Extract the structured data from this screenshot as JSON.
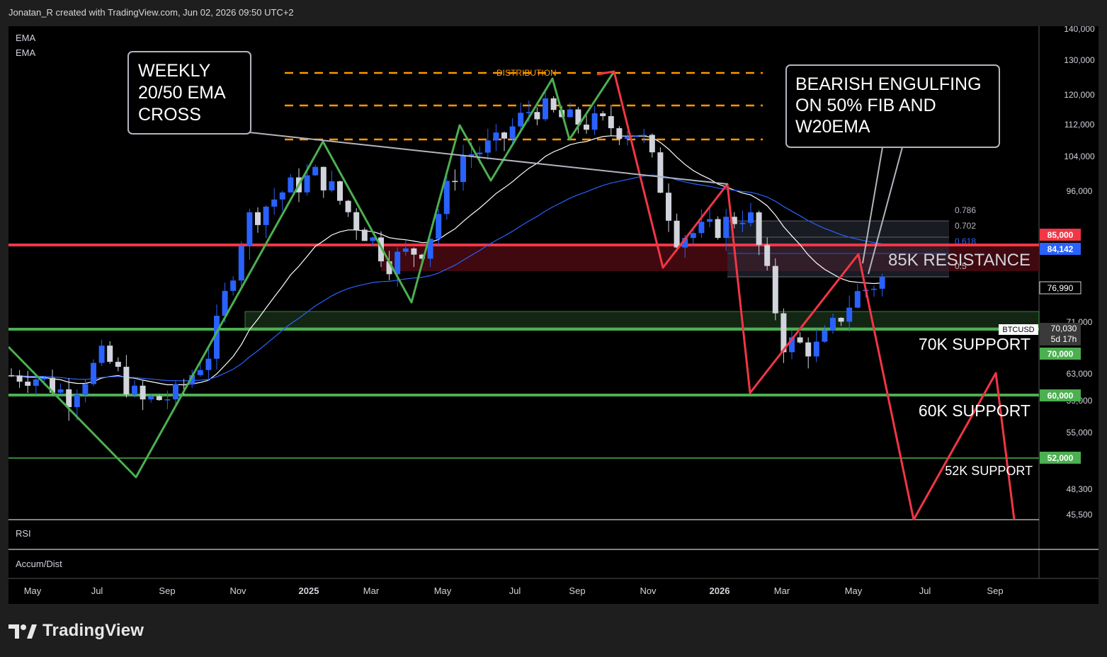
{
  "header": {
    "attribution": "Jonatan_R created with TradingView.com, Jun 02, 2026 09:50 UTC+2"
  },
  "indicators": {
    "ema1": "EMA",
    "ema2": "EMA",
    "rsi": "RSI",
    "accum": "Accum/Dist"
  },
  "footer": {
    "logo_text": "TradingView",
    "logo_icon": "tradingview-logo-icon"
  },
  "annotations": {
    "weekly_cross": [
      "WEEKLY",
      "20/50 EMA",
      "CROSS"
    ],
    "bearish": [
      "BEARISH ENGULFING",
      "ON 50% FIB AND",
      "W20EMA"
    ],
    "distribution": "DISTRIBUTION",
    "resistance_85k": "85K RESISTANCE",
    "support_70k": "70K SUPPORT",
    "support_60k": "60K SUPPORT",
    "support_52k": "52K SUPPORT",
    "fib_labels": [
      "0.786",
      "0.702",
      "0.618",
      "0.5"
    ]
  },
  "price_axis": {
    "ticks": [
      "140,000",
      "130,000",
      "120,000",
      "112,000",
      "104,000",
      "96,000",
      "71,000",
      "63,000",
      "59,000",
      "55,000",
      "48,300",
      "45,500"
    ],
    "labels": {
      "resistance": "85,000",
      "ema": "84,142",
      "last": "76,990",
      "symbol": "BTCUSD",
      "current": "70,030",
      "countdown": "5d 17h",
      "support_70": "70,000",
      "support_60": "60,000",
      "support_52": "52,000"
    },
    "colors": {
      "resistance": "#f23645",
      "ema": "#2962ff",
      "support": "#4caf50",
      "bull": "#2962ff",
      "bear": "#d1d4dc"
    }
  },
  "time_axis": {
    "ticks": [
      "May",
      "Jul",
      "Sep",
      "Nov",
      "2025",
      "Mar",
      "May",
      "Jul",
      "Sep",
      "Nov",
      "2026",
      "Mar",
      "May",
      "Jul",
      "Sep"
    ]
  },
  "chart_data": {
    "type": "candlestick",
    "symbol": "BTCUSD",
    "interval": "weekly",
    "y_range": [
      45500,
      140000
    ],
    "x_range": [
      "2024-04",
      "2026-10"
    ],
    "levels": [
      {
        "name": "85K RESISTANCE",
        "value": 85000
      },
      {
        "name": "70K SUPPORT",
        "value": 70000
      },
      {
        "name": "60K SUPPORT",
        "value": 60000
      },
      {
        "name": "52K SUPPORT",
        "value": 52000
      }
    ],
    "close_path": [
      [
        "2024-05",
        63000
      ],
      [
        "2024-06",
        60000
      ],
      [
        "2024-07",
        66000
      ],
      [
        "2024-08",
        59000
      ],
      [
        "2024-09",
        60000
      ],
      [
        "2024-10",
        67000
      ],
      [
        "2024-11",
        90000
      ],
      [
        "2024-12",
        96000
      ],
      [
        "2025-01",
        100000
      ],
      [
        "2025-02",
        90000
      ],
      [
        "2025-03",
        82000
      ],
      [
        "2025-04",
        85000
      ],
      [
        "2025-05",
        104000
      ],
      [
        "2025-06",
        107000
      ],
      [
        "2025-07",
        117000
      ],
      [
        "2025-08",
        113000
      ],
      [
        "2025-09",
        112000
      ],
      [
        "2025-10",
        110000
      ],
      [
        "2025-11",
        87000
      ],
      [
        "2025-12",
        88000
      ],
      [
        "2026-01",
        92000
      ],
      [
        "2026-02",
        68000
      ],
      [
        "2026-03",
        67000
      ],
      [
        "2026-04",
        76000
      ],
      [
        "2026-05",
        80000
      ],
      [
        "2026-06",
        70030
      ]
    ]
  }
}
